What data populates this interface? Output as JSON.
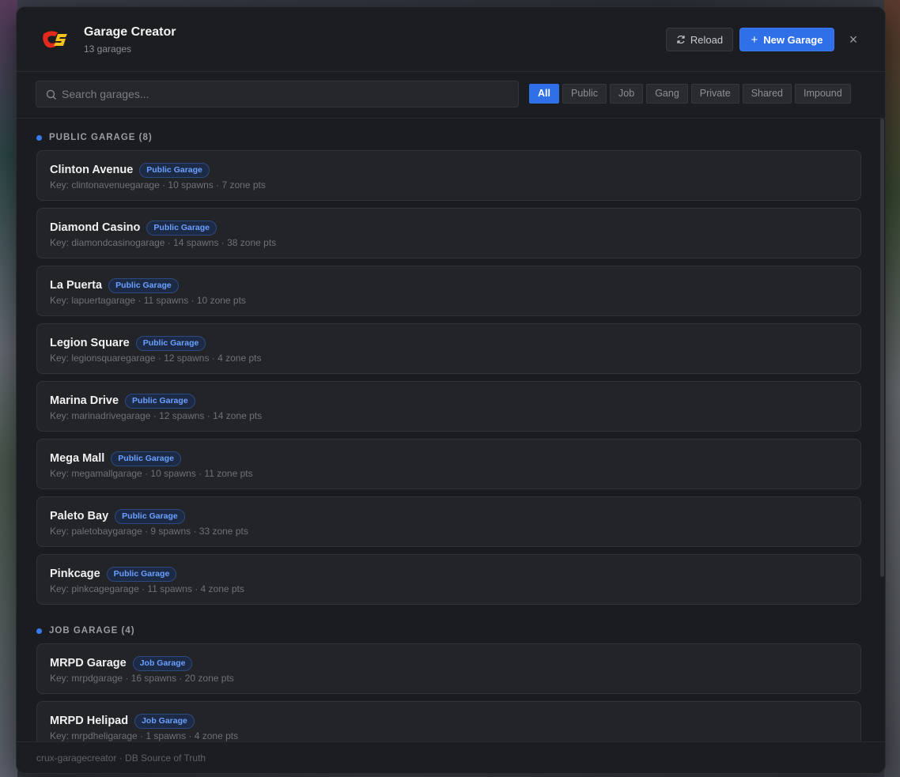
{
  "header": {
    "title": "Garage Creator",
    "subtitle": "13 garages",
    "reload_label": "Reload",
    "new_label": "New Garage",
    "logo_text": "CS"
  },
  "search": {
    "placeholder": "Search garages..."
  },
  "filters": [
    "All",
    "Public",
    "Job",
    "Gang",
    "Private",
    "Shared",
    "Impound"
  ],
  "active_filter": "All",
  "sections": [
    {
      "heading": "PUBLIC GARAGE (8)",
      "items": [
        {
          "name": "Clinton Avenue",
          "badge": "Public Garage",
          "meta": "Key: clintonavenuegarage · 10 spawns · 7 zone pts"
        },
        {
          "name": "Diamond Casino",
          "badge": "Public Garage",
          "meta": "Key: diamondcasinogarage · 14 spawns · 38 zone pts"
        },
        {
          "name": "La Puerta",
          "badge": "Public Garage",
          "meta": "Key: lapuertagarage · 11 spawns · 10 zone pts"
        },
        {
          "name": "Legion Square",
          "badge": "Public Garage",
          "meta": "Key: legionsquaregarage · 12 spawns · 4 zone pts"
        },
        {
          "name": "Marina Drive",
          "badge": "Public Garage",
          "meta": "Key: marinadrivegarage · 12 spawns · 14 zone pts"
        },
        {
          "name": "Mega Mall",
          "badge": "Public Garage",
          "meta": "Key: megamallgarage · 10 spawns · 11 zone pts"
        },
        {
          "name": "Paleto Bay",
          "badge": "Public Garage",
          "meta": "Key: paletobaygarage · 9 spawns · 33 zone pts"
        },
        {
          "name": "Pinkcage",
          "badge": "Public Garage",
          "meta": "Key: pinkcagegarage · 11 spawns · 4 zone pts"
        }
      ]
    },
    {
      "heading": "JOB GARAGE (4)",
      "items": [
        {
          "name": "MRPD Garage",
          "badge": "Job Garage",
          "meta": "Key: mrpdgarage · 16 spawns · 20 zone pts"
        },
        {
          "name": "MRPD Helipad",
          "badge": "Job Garage",
          "meta": "Key: mrpdheligarage · 1 spawns · 4 zone pts"
        }
      ]
    }
  ],
  "footer": {
    "text": "crux-garagecreator · DB Source of Truth"
  },
  "colors": {
    "accent": "#2f6fe8",
    "badge_text": "#6aa0ff",
    "background": "#1b1c1f"
  }
}
